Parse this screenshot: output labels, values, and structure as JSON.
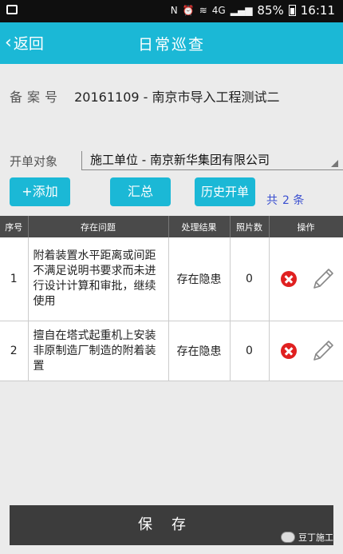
{
  "status_bar": {
    "nfc": "N",
    "network": "4G",
    "battery": "85%",
    "time": "16:11"
  },
  "header": {
    "back_label": "返回",
    "title": "日常巡查"
  },
  "record": {
    "label": "备案号",
    "value": "20161109 - 南京市导入工程测试二"
  },
  "target": {
    "label": "开单对象",
    "selected": "施工单位 - 南京新华集团有限公司"
  },
  "actions": {
    "add": "+添加",
    "summary": "汇总",
    "history": "历史开单"
  },
  "count": {
    "prefix": "共",
    "value": "2",
    "suffix": "条"
  },
  "table": {
    "headers": [
      "序号",
      "存在问题",
      "处理结果",
      "照片数",
      "操作"
    ],
    "rows": [
      {
        "no": "1",
        "issue": "附着装置水平距离或间距不满足说明书要求而未进行设计计算和审批，继续使用",
        "result": "存在隐患",
        "photos": "0"
      },
      {
        "no": "2",
        "issue": "擅自在塔式起重机上安装非原制造厂制造的附着装置",
        "result": "存在隐患",
        "photos": "0"
      }
    ]
  },
  "save_label": "保存",
  "watermark": "豆丁施工",
  "colors": {
    "accent": "#1bb8d6",
    "result_green": "#2a9a2a",
    "delete_red": "#e02020",
    "count_blue": "#3a4fd0"
  }
}
